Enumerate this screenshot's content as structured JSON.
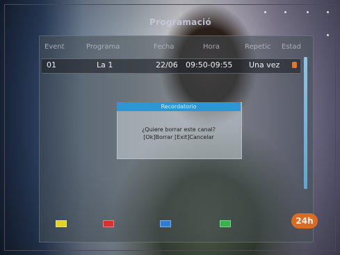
{
  "screen_title": "Programació",
  "columns": [
    "Event",
    "Programa",
    "Fecha",
    "Hora",
    "Repetic",
    "Estad"
  ],
  "rows": [
    {
      "event": "01",
      "programa": "La 1",
      "fecha": "22/06",
      "hora": "09:50-09:55",
      "repetic": "Una vez"
    }
  ],
  "dialog": {
    "title": "Recordatorio",
    "question": "¿Quiere borrar este canal?",
    "options": "[Ok]Borrar [Exit]Cancelar"
  },
  "footer": {
    "keys": [
      {
        "color": "#e2d225",
        "label": ""
      },
      {
        "color": "#d93030",
        "label": ""
      },
      {
        "color": "#2f7cd4",
        "label": ""
      },
      {
        "color": "#34b34a",
        "label": ""
      }
    ]
  },
  "channel_logo": "24h",
  "colors": {
    "accent": "#2e97d3",
    "recording": "#e07a2a",
    "scroll": "#5ea7d2"
  }
}
